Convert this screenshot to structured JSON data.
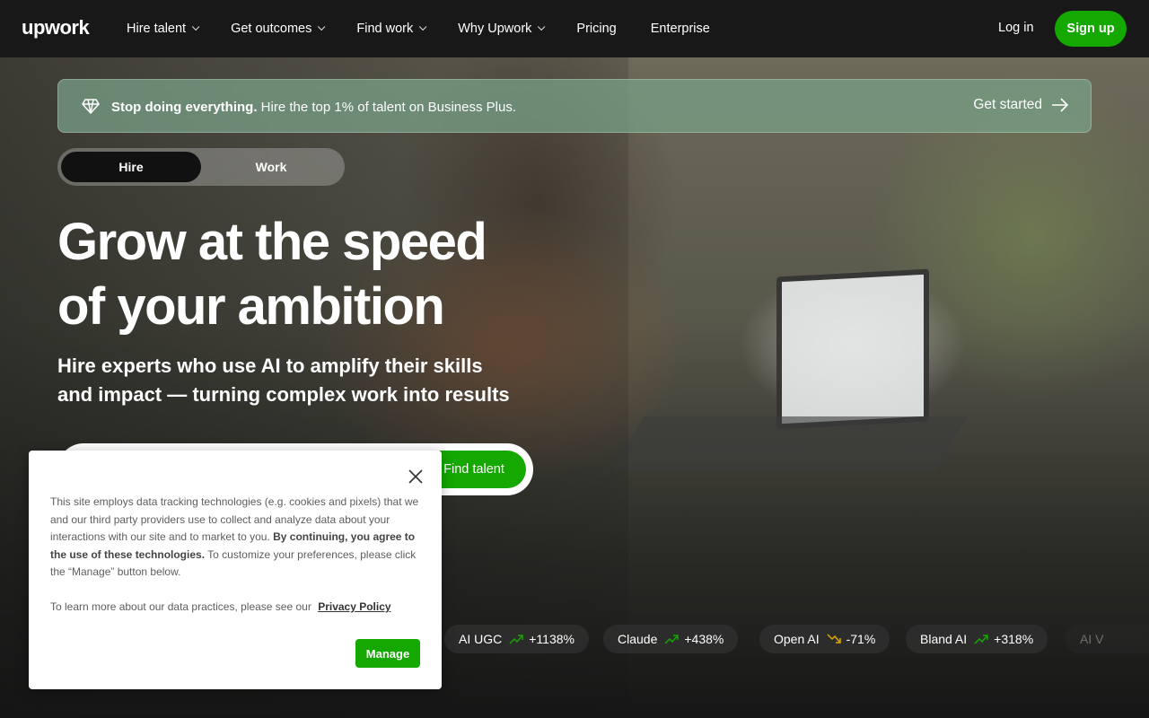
{
  "nav": {
    "logo": "upwork",
    "links": [
      {
        "label": "Hire talent",
        "dropdown": true
      },
      {
        "label": "Get outcomes",
        "dropdown": true
      },
      {
        "label": "Find work",
        "dropdown": true
      },
      {
        "label": "Why Upwork",
        "dropdown": true
      },
      {
        "label": "Pricing",
        "dropdown": false
      },
      {
        "label": "Enterprise",
        "dropdown": false
      }
    ],
    "login": "Log in",
    "signup": "Sign up"
  },
  "promo": {
    "bold": "Stop doing everything.",
    "text": " Hire the top 1% of talent on Business Plus.",
    "cta": "Get started"
  },
  "toggle": {
    "hire": "Hire",
    "work": "Work",
    "selected": "Hire"
  },
  "hero": {
    "line1": "Grow at the speed",
    "line2": "of your ambition",
    "sub1": "Hire experts who use AI to amplify their skills",
    "sub2": "and impact — turning complex work into results"
  },
  "search": {
    "placeholder": "",
    "button": "Find talent"
  },
  "trends": [
    {
      "name": "AI UGC",
      "change": "+1138%",
      "direction": "up"
    },
    {
      "name": "Claude",
      "change": "+438%",
      "direction": "up"
    },
    {
      "name": "Open AI",
      "change": "-71%",
      "direction": "down"
    },
    {
      "name": "Bland AI",
      "change": "+318%",
      "direction": "up"
    },
    {
      "name": "AI V",
      "change": "",
      "direction": "up"
    }
  ],
  "cookie": {
    "p1_start": "This site employs data tracking technologies (e.g. cookies and pixels) that we and our third party providers use to collect and analyze data about your interactions with our site and to market to you. ",
    "p1_bold": "By continuing, you agree to the use of these technologies.",
    "p1_end": " To customize your preferences, please click the “Manage” button below.",
    "p2": "To learn more about our data practices, please see our",
    "privacy_link": "Privacy Policy",
    "manage": "Manage"
  },
  "colors": {
    "brand_green": "#14a800",
    "nav_bg": "#181818",
    "up": "#14a800",
    "down": "#e0a800"
  }
}
